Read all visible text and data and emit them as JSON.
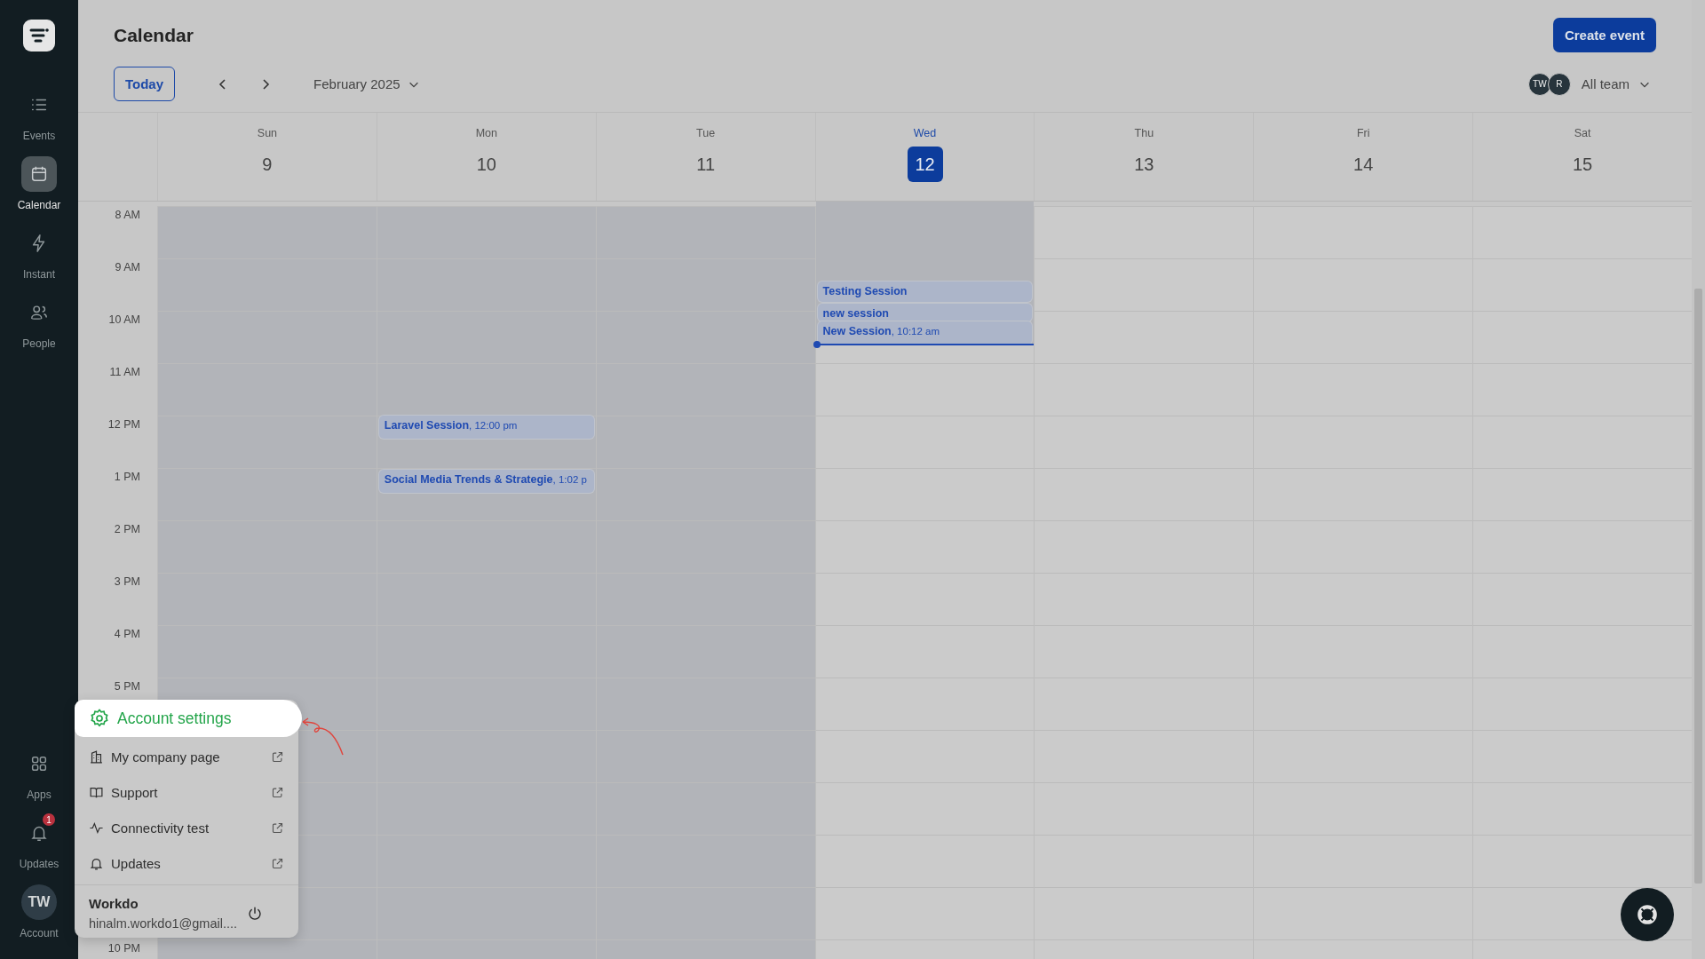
{
  "sidebar": {
    "items": [
      {
        "label": "Events",
        "selected": false
      },
      {
        "label": "Calendar",
        "selected": true
      },
      {
        "label": "Instant",
        "selected": false
      },
      {
        "label": "People",
        "selected": false
      }
    ],
    "bottom_items": [
      {
        "label": "Apps"
      },
      {
        "label": "Updates",
        "badge": "1"
      }
    ],
    "account": {
      "label": "Account",
      "initials": "TW"
    }
  },
  "header": {
    "title": "Calendar",
    "create_button": "Create event",
    "today_button": "Today",
    "month": "February 2025",
    "team": {
      "avatars": [
        "TW",
        "R"
      ],
      "label": "All team"
    }
  },
  "days": [
    {
      "name": "Sun",
      "date": "9",
      "past": true,
      "selected": false
    },
    {
      "name": "Mon",
      "date": "10",
      "past": true,
      "selected": false,
      "events": [
        "**Laravel Session**, 12:00 pm",
        "**Social Media Trends & Strategie**, 1:02 p"
      ]
    },
    {
      "name": "Tue",
      "date": "11",
      "past": true,
      "selected": false
    },
    {
      "name": "Wed",
      "date": "12",
      "past": false,
      "selected": true,
      "events": [
        "**Testing Session**",
        "**new session**",
        "**New Session**, 10:12 am"
      ]
    },
    {
      "name": "Thu",
      "date": "13",
      "past": false,
      "selected": false
    },
    {
      "name": "Fri",
      "date": "14",
      "past": false,
      "selected": false
    },
    {
      "name": "Sat",
      "date": "15",
      "past": false,
      "selected": false
    }
  ],
  "hours_above_menu": [
    "8 AM",
    "9 AM",
    "10 AM",
    "11 AM",
    "12 PM",
    "1 PM",
    "2 PM",
    "3 PM",
    "4 PM",
    "5 PM"
  ],
  "hours_below_menu": [
    "10 PM"
  ],
  "menu": {
    "items": [
      {
        "label": "Account settings",
        "selected": true,
        "external": false
      },
      {
        "label": "My company page",
        "selected": false,
        "external": true
      },
      {
        "label": "Support",
        "selected": false,
        "external": true
      },
      {
        "label": "Connectivity test",
        "selected": false,
        "external": true
      },
      {
        "label": "Updates",
        "selected": false,
        "external": true
      }
    ],
    "account": {
      "name": "Workdo",
      "email": "hinalm.workdo1@gmail...."
    }
  }
}
